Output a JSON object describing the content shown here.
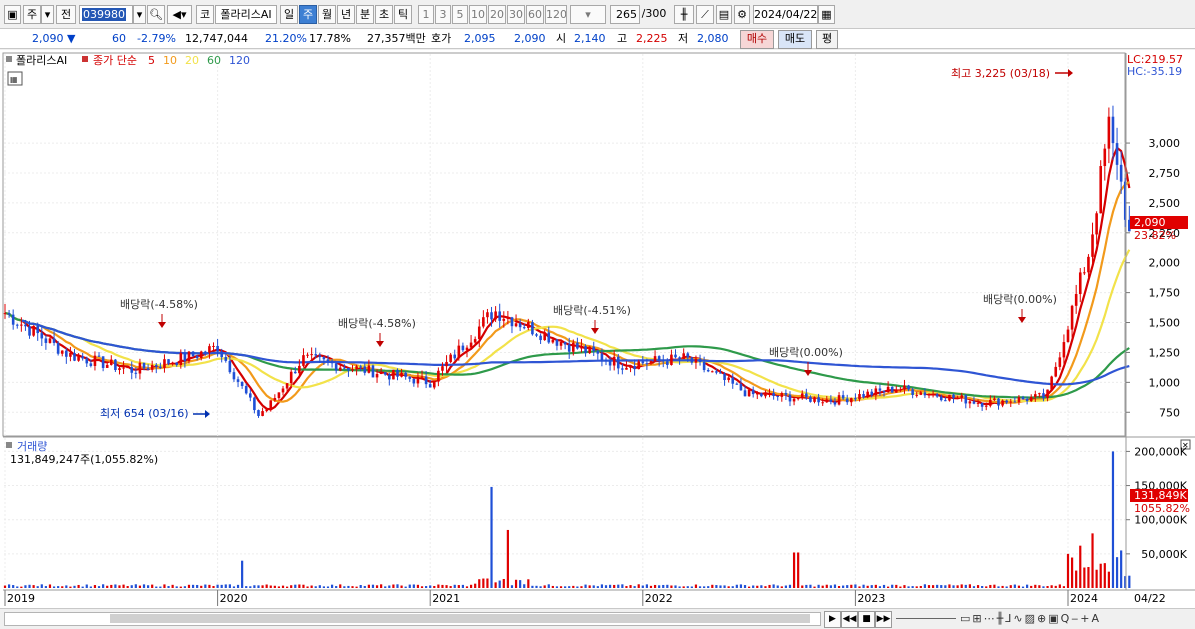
{
  "toolbar": {
    "type_label": "주",
    "prev_label": "전",
    "stock_code": "039980",
    "stock_type": "코",
    "stock_name": "폴라리스AI",
    "periods": [
      "일",
      "주",
      "월",
      "년",
      "분",
      "초",
      "틱"
    ],
    "active_period": "주",
    "intervals": [
      "1",
      "3",
      "5",
      "10",
      "20",
      "30",
      "60",
      "120"
    ],
    "count": "265",
    "count_total": "/300",
    "date": "2024/04/22"
  },
  "quote": {
    "price": "2,090",
    "change": "60",
    "change_pct": "-2.79%",
    "volume": "12,747,044",
    "vol_ratio1": "21.20%",
    "vol_ratio2": "17.78%",
    "amount": "27,357백만",
    "bid_label": "호가",
    "bid1": "2,095",
    "bid2": "2,090",
    "open_label": "시",
    "open": "2,140",
    "high_label": "고",
    "high": "2,225",
    "low_label": "저",
    "low": "2,080",
    "buy_label": "매수",
    "sell_label": "매도",
    "eval_label": "평"
  },
  "price_panel": {
    "name_label": "폴라리스AI",
    "ma_label": "종가 단순",
    "ma_periods": [
      "5",
      "10",
      "20",
      "60",
      "120"
    ],
    "ma_colors": [
      "#d40000",
      "#f29a1b",
      "#f2e24a",
      "#2e9a4a",
      "#2f55d4"
    ],
    "lc": "LC:219.57",
    "hc": "HC:-35.19",
    "price_tag": "2,090",
    "pct_tag": "23.82%",
    "high_note": "최고 3,225 (03/18)",
    "low_note": "최저 654 (03/16)",
    "dividends": [
      "배당락(-4.58%)",
      "배당락(-4.58%)",
      "배당락(-4.51%)",
      "배당락(0.00%)",
      "배당락(0.00%)"
    ]
  },
  "volume_panel": {
    "title": "거래량",
    "value_text": "131,849,247주(1,055.82%)",
    "value_tag": "131,849K",
    "pct_tag": "1055.82%"
  },
  "chart_data": [
    {
      "type": "candlestick",
      "title": "폴라리스AI",
      "y_ticks": [
        "3,000",
        "2,750",
        "2,500",
        "2,250",
        "2,000",
        "1,750",
        "1,500",
        "1,250",
        "1,000",
        "750"
      ],
      "ylim": [
        560,
        3360
      ],
      "x_ticks": [
        "2019",
        "2020",
        "2021",
        "2022",
        "2023",
        "2024",
        "04/22"
      ],
      "period": "weekly",
      "series": [
        {
          "name": "종가",
          "approx_points": [
            [
              2019.0,
              1580
            ],
            [
              2019.3,
              1230
            ],
            [
              2019.6,
              1100
            ],
            [
              2019.9,
              1230
            ],
            [
              2020.0,
              1300
            ],
            [
              2020.2,
              700
            ],
            [
              2020.4,
              1200
            ],
            [
              2020.7,
              1100
            ],
            [
              2021.0,
              1000
            ],
            [
              2021.3,
              1600
            ],
            [
              2021.6,
              1350
            ],
            [
              2021.9,
              1150
            ],
            [
              2022.2,
              1200
            ],
            [
              2022.5,
              900
            ],
            [
              2022.9,
              850
            ],
            [
              2023.2,
              950
            ],
            [
              2023.6,
              830
            ],
            [
              2023.9,
              880
            ],
            [
              2024.1,
              2100
            ],
            [
              2024.2,
              3225
            ],
            [
              2024.3,
              2090
            ]
          ]
        }
      ],
      "annotations": [
        "최고 3,225 (03/18)",
        "최저 654 (03/16)"
      ]
    },
    {
      "type": "bar",
      "title": "거래량",
      "y_ticks": [
        "200,000K",
        "150,000K",
        "100,000K",
        "50,000K"
      ],
      "ylim": [
        0,
        205000
      ],
      "last_value": 131849
    }
  ]
}
